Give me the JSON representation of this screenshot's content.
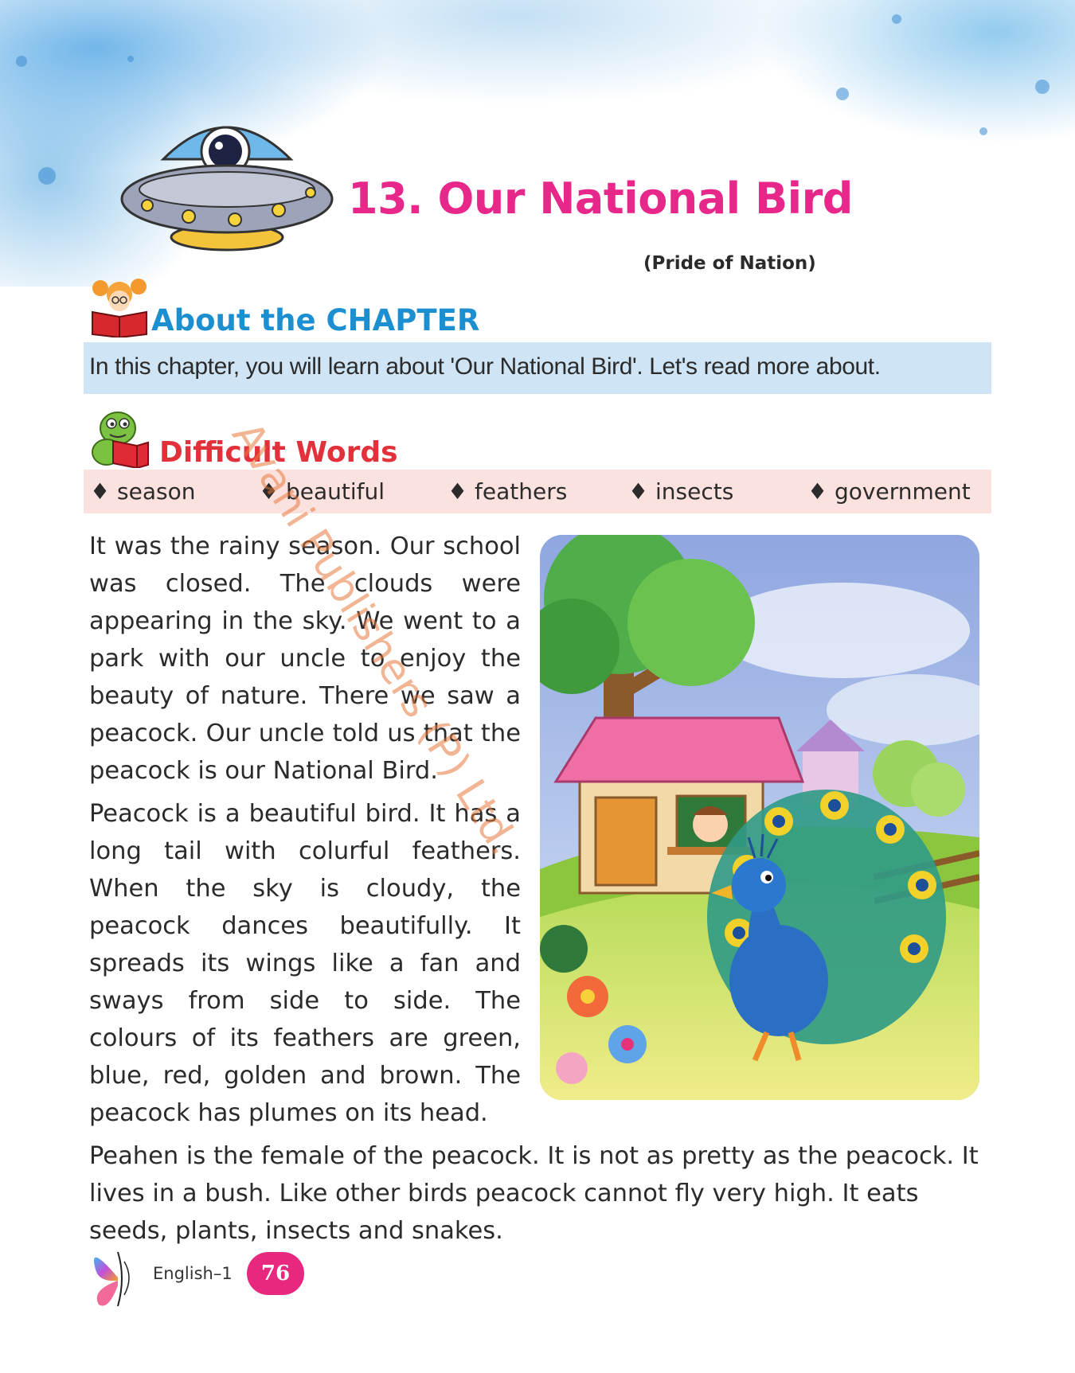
{
  "chapter": {
    "title": "13. Our National Bird",
    "subtitle": "(Pride of Nation)"
  },
  "about": {
    "heading": "About the CHAPTER",
    "text": "In this chapter, you will learn about 'Our National Bird'. Let's read more about."
  },
  "difficult_words": {
    "heading": "Difficult Words",
    "bullet": "♦",
    "words": [
      "season",
      "beautiful",
      "feathers",
      "insects",
      "government"
    ]
  },
  "paragraphs": [
    "It was the rainy season. Our school was closed. The clouds were appearing in the sky. We went to a park with our uncle to enjoy the beauty of nature. There we saw a peacock. Our uncle told us that the peacock is our National Bird.",
    "Peacock is a beautiful bird. It has a long tail with colurful feathers. When the sky is cloudy, the peacock dances beautifully. It spreads its wings like a fan and sways from side to side. The colours of its feathers are green, blue, red, golden and brown. The peacock has plumes on its head.",
    "Peahen is the female of the peacock. It is not as pretty as the peacock. It lives in a bush. Like other birds peacock cannot fly very high. It eats seeds, plants, insects and snakes."
  ],
  "watermark": "Avani Publishers (P) Ltd.",
  "footer": {
    "book": "English–1",
    "page": "76"
  },
  "colors": {
    "title": "#e8278a",
    "about_heading": "#1b8fcf",
    "about_box": "#cfe4f4",
    "dw_heading": "#e3313c",
    "dw_box": "#fbe2df",
    "page_badge": "#e8277f"
  },
  "icons": [
    "ufo-astronaut-illustration",
    "reading-girl-icon",
    "reading-dino-icon",
    "butterfly-logo-icon"
  ]
}
